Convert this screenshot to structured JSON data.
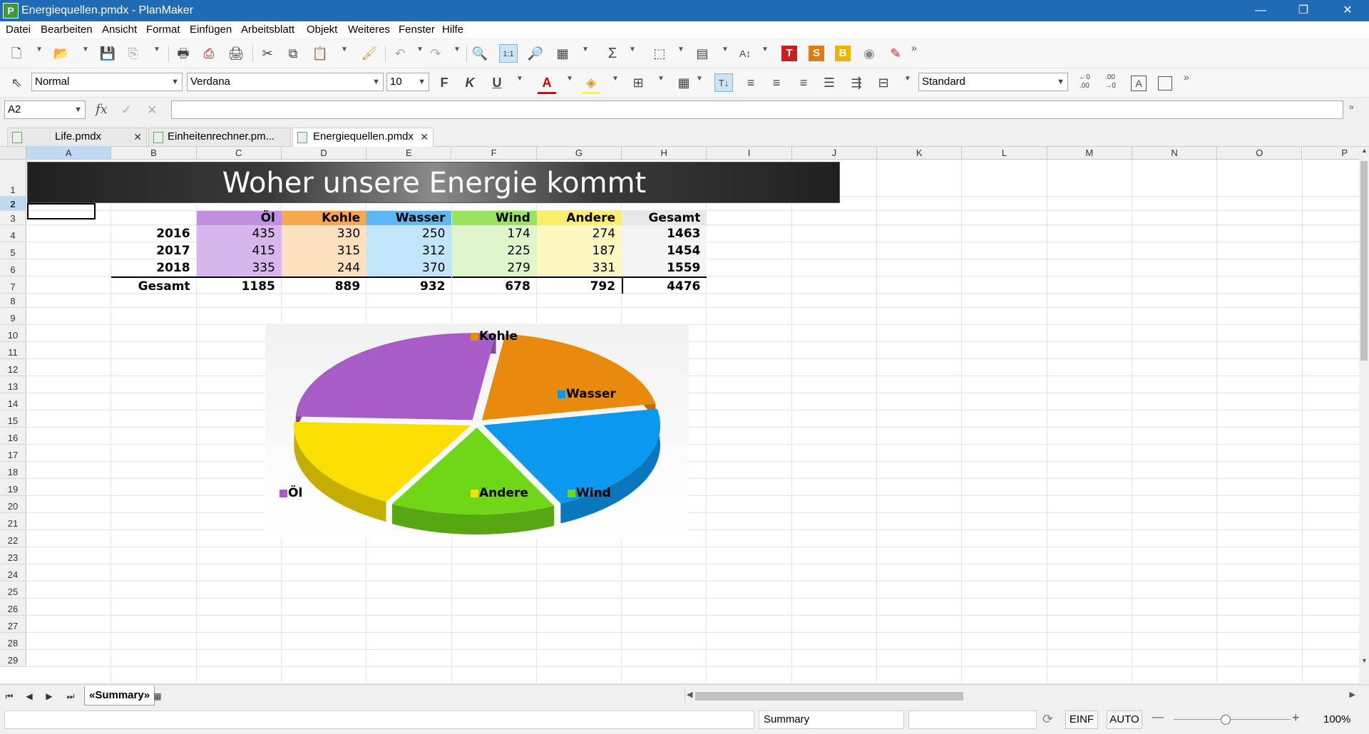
{
  "window": {
    "title": "Energiequellen.pmdx - PlanMaker",
    "app_letter": "P"
  },
  "menu": [
    "Datei",
    "Bearbeiten",
    "Ansicht",
    "Format",
    "Einfügen",
    "Arbeitsblatt",
    "Objekt",
    "Weiteres",
    "Fenster",
    "Hilfe"
  ],
  "format_bar": {
    "style": "Normal",
    "font": "Verdana",
    "size": "10",
    "bold": "F",
    "italic": "K",
    "underline": "U",
    "number_format": "Standard"
  },
  "formula_bar": {
    "cell_ref": "A2",
    "fx": "fx",
    "formula": ""
  },
  "doc_tabs": [
    {
      "label": "Life.pmdx"
    },
    {
      "label": "Einheitenrechner.pm..."
    },
    {
      "label": "Energiequellen.pmdx"
    }
  ],
  "columns": [
    "A",
    "B",
    "C",
    "D",
    "E",
    "F",
    "G",
    "H",
    "I",
    "J",
    "K",
    "L",
    "M",
    "N",
    "O",
    "P"
  ],
  "rows": [
    "1",
    "2",
    "3",
    "4",
    "5",
    "6",
    "7",
    "8",
    "9",
    "10",
    "11",
    "12",
    "13",
    "14",
    "15",
    "16",
    "17",
    "18",
    "19",
    "20",
    "21",
    "22",
    "23",
    "24",
    "25",
    "26",
    "27",
    "28",
    "29"
  ],
  "sheet": {
    "banner": "Woher unsere Energie kommt",
    "headers": [
      "Öl",
      "Kohle",
      "Wasser",
      "Wind",
      "Andere",
      "Gesamt"
    ],
    "data_rows": [
      {
        "year": "2016",
        "values": [
          "435",
          "330",
          "250",
          "174",
          "274"
        ],
        "total": "1463"
      },
      {
        "year": "2017",
        "values": [
          "415",
          "315",
          "312",
          "225",
          "187"
        ],
        "total": "1454"
      },
      {
        "year": "2018",
        "values": [
          "335",
          "244",
          "370",
          "279",
          "331"
        ],
        "total": "1559"
      }
    ],
    "total_label": "Gesamt",
    "totals": [
      "1185",
      "889",
      "932",
      "678",
      "792"
    ],
    "grand_total": "4476"
  },
  "colors": {
    "header": [
      "#c18fe0",
      "#f7a64c",
      "#5bb7f5",
      "#9be35e",
      "#fbee6a",
      "#e8e8e8"
    ],
    "body": [
      "#d6b6ec",
      "#fde0c0",
      "#c3e5fb",
      "#dff6cd",
      "#fff7c0",
      "#f4f4f4"
    ],
    "slices": [
      "#a85cc8",
      "#e98a0c",
      "#0a98f0",
      "#6fd618",
      "#fbdf00"
    ]
  },
  "chart_data": {
    "type": "pie",
    "categories": [
      "Öl",
      "Kohle",
      "Wasser",
      "Wind",
      "Andere"
    ],
    "values": [
      1185,
      889,
      932,
      678,
      792
    ],
    "legend_labels": [
      "Öl",
      "Kohle",
      "Wasser",
      "Wind",
      "Andere"
    ],
    "style": "3D exploded"
  },
  "sheet_tabs": {
    "active": "«Summary»"
  },
  "status": {
    "sheet": "Summary",
    "mode_insert": "EINF",
    "mode_auto": "AUTO",
    "zoom": "100%"
  }
}
